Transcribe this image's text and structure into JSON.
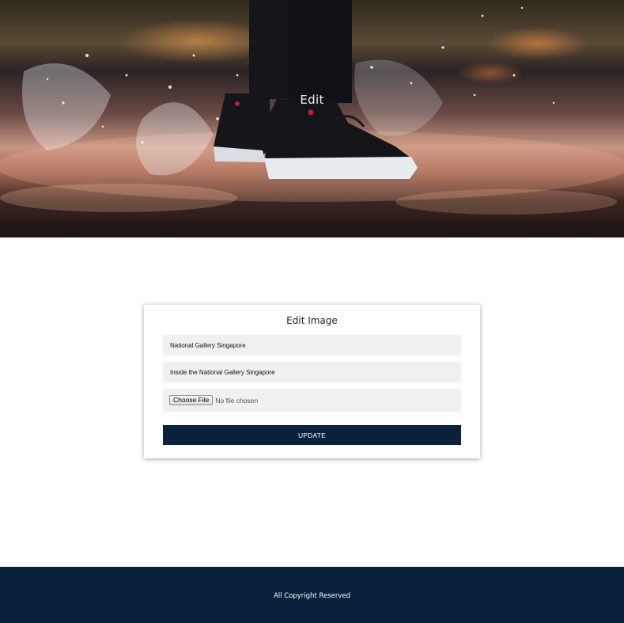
{
  "hero": {
    "title": "Edit",
    "image_subject": "sneakers-splashing-in-puddle"
  },
  "form": {
    "heading": "Edit Image",
    "name_value": "National Gallery Singapore",
    "description_value": "Inside the National Gallery Singapore",
    "file_button_label": "Choose File",
    "file_status": "No file chosen",
    "submit_label": "UPDATE"
  },
  "footer": {
    "text": "All Copyright Reserved"
  },
  "colors": {
    "primary_navy": "#0a213b",
    "field_background": "#f0f0f0"
  }
}
